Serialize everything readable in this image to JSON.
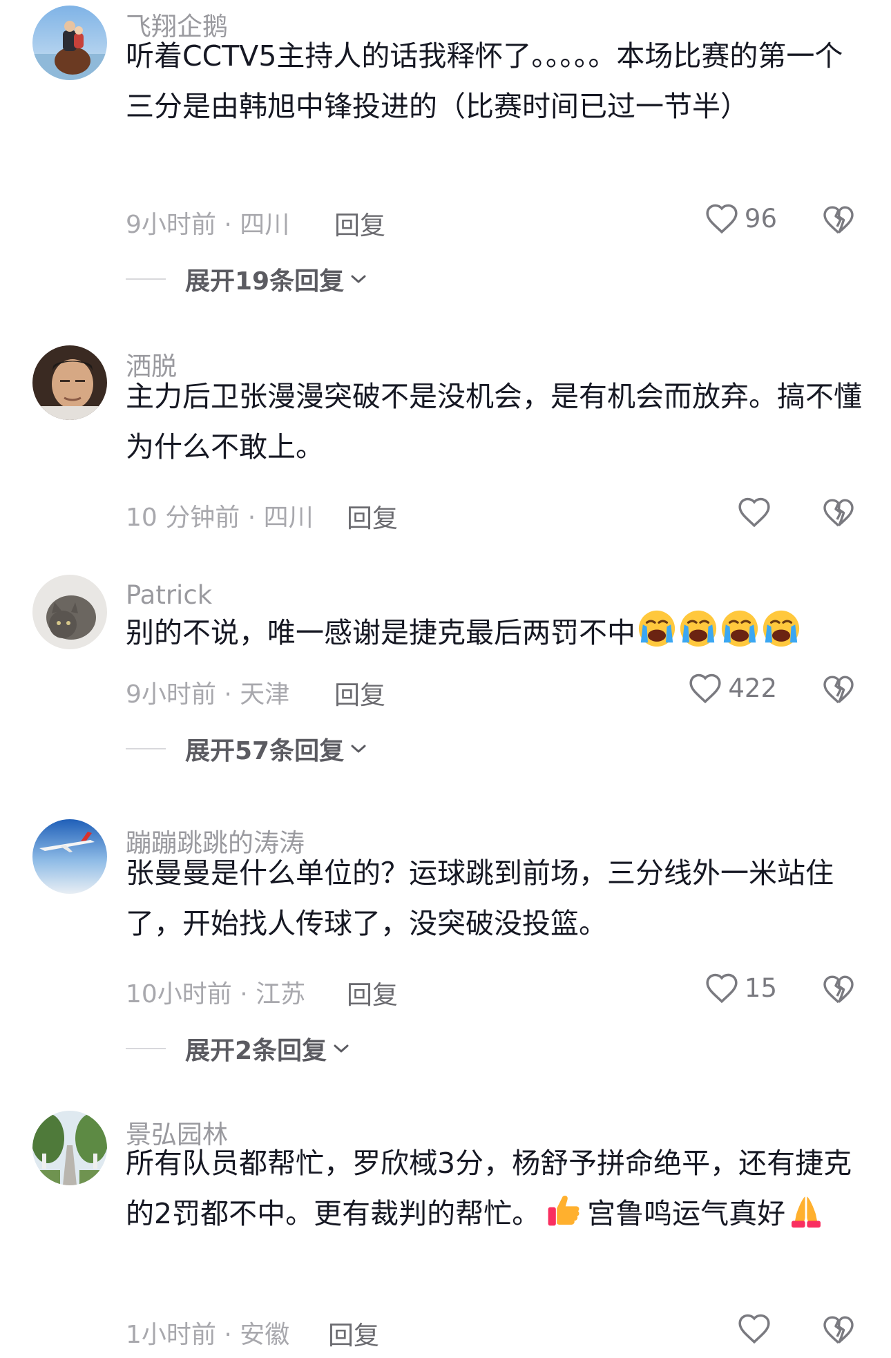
{
  "comments": [
    {
      "username": "飞翔企鹅",
      "text": "听着CCTV5主持人的话我释怀了。。。。。本场比赛的第一个三分是由韩旭中锋投进的（比赛时间已过一节半）",
      "meta": "9小时前 · 四川",
      "reply_label": "回复",
      "likes": "96",
      "expand_label": "展开19条回复",
      "avatar_icon": "rider-photo-avatar"
    },
    {
      "username": "洒脱",
      "text": "主力后卫张漫漫突破不是没机会，是有机会而放弃。搞不懂为什么不敢上。",
      "meta": "10 分钟前 · 四川",
      "reply_label": "回复",
      "likes": "",
      "avatar_icon": "man-portrait-avatar"
    },
    {
      "username": "Patrick",
      "text": "别的不说，唯一感谢是捷克最后两罚不中",
      "emoji": [
        "loudly-crying-face",
        "loudly-crying-face",
        "loudly-crying-face",
        "loudly-crying-face"
      ],
      "meta": "9小时前 · 天津",
      "reply_label": "回复",
      "likes": "422",
      "expand_label": "展开57条回复",
      "avatar_icon": "cat-avatar"
    },
    {
      "username": "蹦蹦跳跳的涛涛",
      "text": "张曼曼是什么单位的？运球跳到前场，三分线外一米站住了，开始找人传球了，没突破没投篮。",
      "meta": "10小时前 · 江苏",
      "reply_label": "回复",
      "likes": "15",
      "expand_label": "展开2条回复",
      "avatar_icon": "airplane-sky-avatar"
    },
    {
      "username": "景弘园林",
      "text_a": "所有队员都帮忙，罗欣棫3分，杨舒予拼命绝平，还有捷克的2罚都不中。更有裁判的帮忙。",
      "text_b": "宫鲁鸣运气真好",
      "emoji_a": "thumbs-up",
      "emoji_b": "folded-hands",
      "meta": "1小时前 · 安徽",
      "reply_label": "回复",
      "likes": "",
      "avatar_icon": "garden-road-avatar"
    }
  ],
  "colors": {
    "username": "#9a9a9f",
    "text": "#161823",
    "meta": "#a8a8ad",
    "icon": "#7a7a80"
  }
}
